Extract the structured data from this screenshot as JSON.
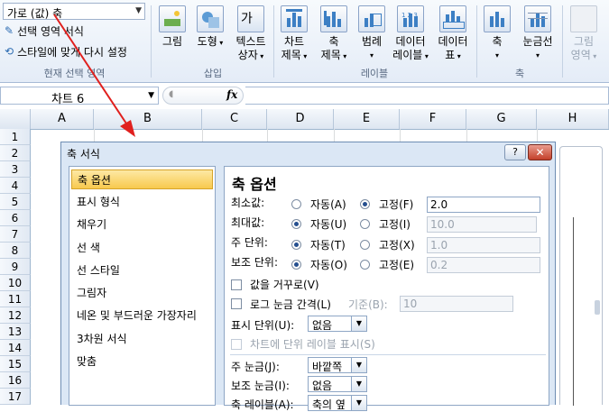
{
  "ribbon": {
    "current_selection": {
      "combo_value": "가로 (값) 축",
      "format_selection": "선택 영역 서식",
      "reset_style": "스타일에 맞게 다시 설정",
      "group_label": "현재 선택 영역"
    },
    "insert_group": {
      "picture": "그림",
      "shapes": "도형",
      "textbox": "텍스트",
      "textbox2": "상자",
      "group_label": "삽입"
    },
    "labels_group": {
      "chart_title": "차트",
      "chart_title2": "제목",
      "axis_titles": "축",
      "axis_titles2": "제목",
      "legend": "범례",
      "data_labels": "데이터",
      "data_labels2": "레이블",
      "data_table": "데이터",
      "data_table2": "표",
      "group_label": "레이블"
    },
    "axes_group": {
      "axes": "축",
      "gridlines": "눈금선",
      "group_label": "축"
    },
    "background_group": {
      "plot_area": "그림",
      "plot_area2": "영역"
    }
  },
  "formula_bar": {
    "name_box": "차트 6",
    "fx": "fx"
  },
  "grid": {
    "columns": [
      "A",
      "B",
      "C",
      "D",
      "E",
      "F",
      "G",
      "H"
    ],
    "rows": [
      "1",
      "2",
      "3",
      "4",
      "5",
      "6",
      "7",
      "8",
      "9",
      "10",
      "11",
      "12",
      "13",
      "14",
      "15",
      "16",
      "17"
    ]
  },
  "dialog": {
    "title": "축 서식",
    "help": "?",
    "close": "✕",
    "categories": [
      "축 옵션",
      "표시 형식",
      "채우기",
      "선 색",
      "선 스타일",
      "그림자",
      "네온 및 부드러운 가장자리",
      "3차원 서식",
      "맞춤"
    ],
    "selected_category": "축 옵션",
    "panel": {
      "title": "축 옵션",
      "minimum": {
        "label": "최소값:",
        "auto": "자동(A)",
        "fixed": "고정(F)",
        "value": "2.0",
        "selected": "fixed"
      },
      "maximum": {
        "label": "최대값:",
        "auto": "자동(U)",
        "fixed": "고정(I)",
        "value": "10.0",
        "selected": "auto"
      },
      "major_unit": {
        "label": "주 단위:",
        "auto": "자동(T)",
        "fixed": "고정(X)",
        "value": "1.0",
        "selected": "auto"
      },
      "minor_unit": {
        "label": "보조 단위:",
        "auto": "자동(O)",
        "fixed": "고정(E)",
        "value": "0.2",
        "selected": "auto"
      },
      "reverse_order": "값을 거꾸로(V)",
      "log_scale": "로그 눈금 간격(L)",
      "log_base_label": "기준(B):",
      "log_base_value": "10",
      "display_units_label": "표시 단위(U):",
      "display_units_value": "없음",
      "show_units_label": "차트에 단위 레이블 표시(S)",
      "major_tick_label": "주 눈금(J):",
      "major_tick_value": "바깥쪽",
      "minor_tick_label": "보조 눈금(I):",
      "minor_tick_value": "없음",
      "axis_labels_label": "축 레이블(A):",
      "axis_labels_value": "축의 옆"
    }
  },
  "colors": {
    "selected_category": "#f8c94e",
    "arrow": "#e0201e",
    "dialog_bg": "#dbe7f5"
  }
}
